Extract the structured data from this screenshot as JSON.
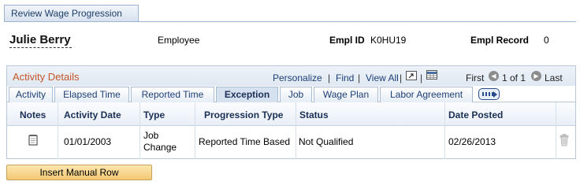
{
  "page_tab": {
    "label": "Review Wage Progression"
  },
  "header": {
    "name": "Julie Berry",
    "role": "Employee",
    "empl_id_label": "Empl ID",
    "empl_id_value": "K0HU19",
    "empl_record_label": "Empl Record",
    "empl_record_value": "0"
  },
  "grid": {
    "title": "Activity Details",
    "personalize": "Personalize",
    "find": "Find",
    "view_all": "View All",
    "separator": "|",
    "first": "First",
    "range": "1 of 1",
    "last": "Last",
    "tabs": [
      {
        "label": "Activity"
      },
      {
        "label": "Elapsed Time"
      },
      {
        "label": "Reported Time"
      },
      {
        "label": "Exception"
      },
      {
        "label": "Job"
      },
      {
        "label": "Wage Plan"
      },
      {
        "label": "Labor Agreement"
      }
    ],
    "active_tab": "Exception",
    "columns": [
      "Notes",
      "Activity Date",
      "Type",
      "Progression Type",
      "Status",
      "Date Posted"
    ],
    "rows": [
      {
        "activity_date": "01/01/2003",
        "type_line1": "Job",
        "type_line2": "Change",
        "progression_type": "Reported Time Based",
        "status": "Not Qualified",
        "date_posted": "02/26/2013"
      }
    ]
  },
  "buttons": {
    "insert_manual_row": "Insert Manual Row"
  },
  "colors": {
    "accent_title": "#c4562a",
    "link": "#1d3f76",
    "button": "#f2c874"
  }
}
